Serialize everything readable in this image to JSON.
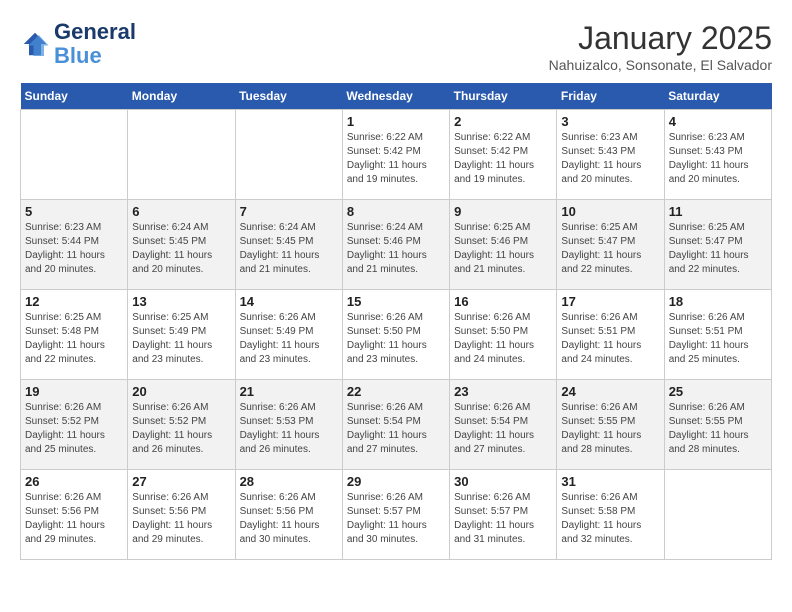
{
  "header": {
    "logo_line1": "General",
    "logo_line2": "Blue",
    "month": "January 2025",
    "location": "Nahuizalco, Sonsonate, El Salvador"
  },
  "weekdays": [
    "Sunday",
    "Monday",
    "Tuesday",
    "Wednesday",
    "Thursday",
    "Friday",
    "Saturday"
  ],
  "weeks": [
    [
      {
        "day": "",
        "info": ""
      },
      {
        "day": "",
        "info": ""
      },
      {
        "day": "",
        "info": ""
      },
      {
        "day": "1",
        "info": "Sunrise: 6:22 AM\nSunset: 5:42 PM\nDaylight: 11 hours\nand 19 minutes."
      },
      {
        "day": "2",
        "info": "Sunrise: 6:22 AM\nSunset: 5:42 PM\nDaylight: 11 hours\nand 19 minutes."
      },
      {
        "day": "3",
        "info": "Sunrise: 6:23 AM\nSunset: 5:43 PM\nDaylight: 11 hours\nand 20 minutes."
      },
      {
        "day": "4",
        "info": "Sunrise: 6:23 AM\nSunset: 5:43 PM\nDaylight: 11 hours\nand 20 minutes."
      }
    ],
    [
      {
        "day": "5",
        "info": "Sunrise: 6:23 AM\nSunset: 5:44 PM\nDaylight: 11 hours\nand 20 minutes."
      },
      {
        "day": "6",
        "info": "Sunrise: 6:24 AM\nSunset: 5:45 PM\nDaylight: 11 hours\nand 20 minutes."
      },
      {
        "day": "7",
        "info": "Sunrise: 6:24 AM\nSunset: 5:45 PM\nDaylight: 11 hours\nand 21 minutes."
      },
      {
        "day": "8",
        "info": "Sunrise: 6:24 AM\nSunset: 5:46 PM\nDaylight: 11 hours\nand 21 minutes."
      },
      {
        "day": "9",
        "info": "Sunrise: 6:25 AM\nSunset: 5:46 PM\nDaylight: 11 hours\nand 21 minutes."
      },
      {
        "day": "10",
        "info": "Sunrise: 6:25 AM\nSunset: 5:47 PM\nDaylight: 11 hours\nand 22 minutes."
      },
      {
        "day": "11",
        "info": "Sunrise: 6:25 AM\nSunset: 5:47 PM\nDaylight: 11 hours\nand 22 minutes."
      }
    ],
    [
      {
        "day": "12",
        "info": "Sunrise: 6:25 AM\nSunset: 5:48 PM\nDaylight: 11 hours\nand 22 minutes."
      },
      {
        "day": "13",
        "info": "Sunrise: 6:25 AM\nSunset: 5:49 PM\nDaylight: 11 hours\nand 23 minutes."
      },
      {
        "day": "14",
        "info": "Sunrise: 6:26 AM\nSunset: 5:49 PM\nDaylight: 11 hours\nand 23 minutes."
      },
      {
        "day": "15",
        "info": "Sunrise: 6:26 AM\nSunset: 5:50 PM\nDaylight: 11 hours\nand 23 minutes."
      },
      {
        "day": "16",
        "info": "Sunrise: 6:26 AM\nSunset: 5:50 PM\nDaylight: 11 hours\nand 24 minutes."
      },
      {
        "day": "17",
        "info": "Sunrise: 6:26 AM\nSunset: 5:51 PM\nDaylight: 11 hours\nand 24 minutes."
      },
      {
        "day": "18",
        "info": "Sunrise: 6:26 AM\nSunset: 5:51 PM\nDaylight: 11 hours\nand 25 minutes."
      }
    ],
    [
      {
        "day": "19",
        "info": "Sunrise: 6:26 AM\nSunset: 5:52 PM\nDaylight: 11 hours\nand 25 minutes."
      },
      {
        "day": "20",
        "info": "Sunrise: 6:26 AM\nSunset: 5:52 PM\nDaylight: 11 hours\nand 26 minutes."
      },
      {
        "day": "21",
        "info": "Sunrise: 6:26 AM\nSunset: 5:53 PM\nDaylight: 11 hours\nand 26 minutes."
      },
      {
        "day": "22",
        "info": "Sunrise: 6:26 AM\nSunset: 5:54 PM\nDaylight: 11 hours\nand 27 minutes."
      },
      {
        "day": "23",
        "info": "Sunrise: 6:26 AM\nSunset: 5:54 PM\nDaylight: 11 hours\nand 27 minutes."
      },
      {
        "day": "24",
        "info": "Sunrise: 6:26 AM\nSunset: 5:55 PM\nDaylight: 11 hours\nand 28 minutes."
      },
      {
        "day": "25",
        "info": "Sunrise: 6:26 AM\nSunset: 5:55 PM\nDaylight: 11 hours\nand 28 minutes."
      }
    ],
    [
      {
        "day": "26",
        "info": "Sunrise: 6:26 AM\nSunset: 5:56 PM\nDaylight: 11 hours\nand 29 minutes."
      },
      {
        "day": "27",
        "info": "Sunrise: 6:26 AM\nSunset: 5:56 PM\nDaylight: 11 hours\nand 29 minutes."
      },
      {
        "day": "28",
        "info": "Sunrise: 6:26 AM\nSunset: 5:56 PM\nDaylight: 11 hours\nand 30 minutes."
      },
      {
        "day": "29",
        "info": "Sunrise: 6:26 AM\nSunset: 5:57 PM\nDaylight: 11 hours\nand 30 minutes."
      },
      {
        "day": "30",
        "info": "Sunrise: 6:26 AM\nSunset: 5:57 PM\nDaylight: 11 hours\nand 31 minutes."
      },
      {
        "day": "31",
        "info": "Sunrise: 6:26 AM\nSunset: 5:58 PM\nDaylight: 11 hours\nand 32 minutes."
      },
      {
        "day": "",
        "info": ""
      }
    ]
  ]
}
